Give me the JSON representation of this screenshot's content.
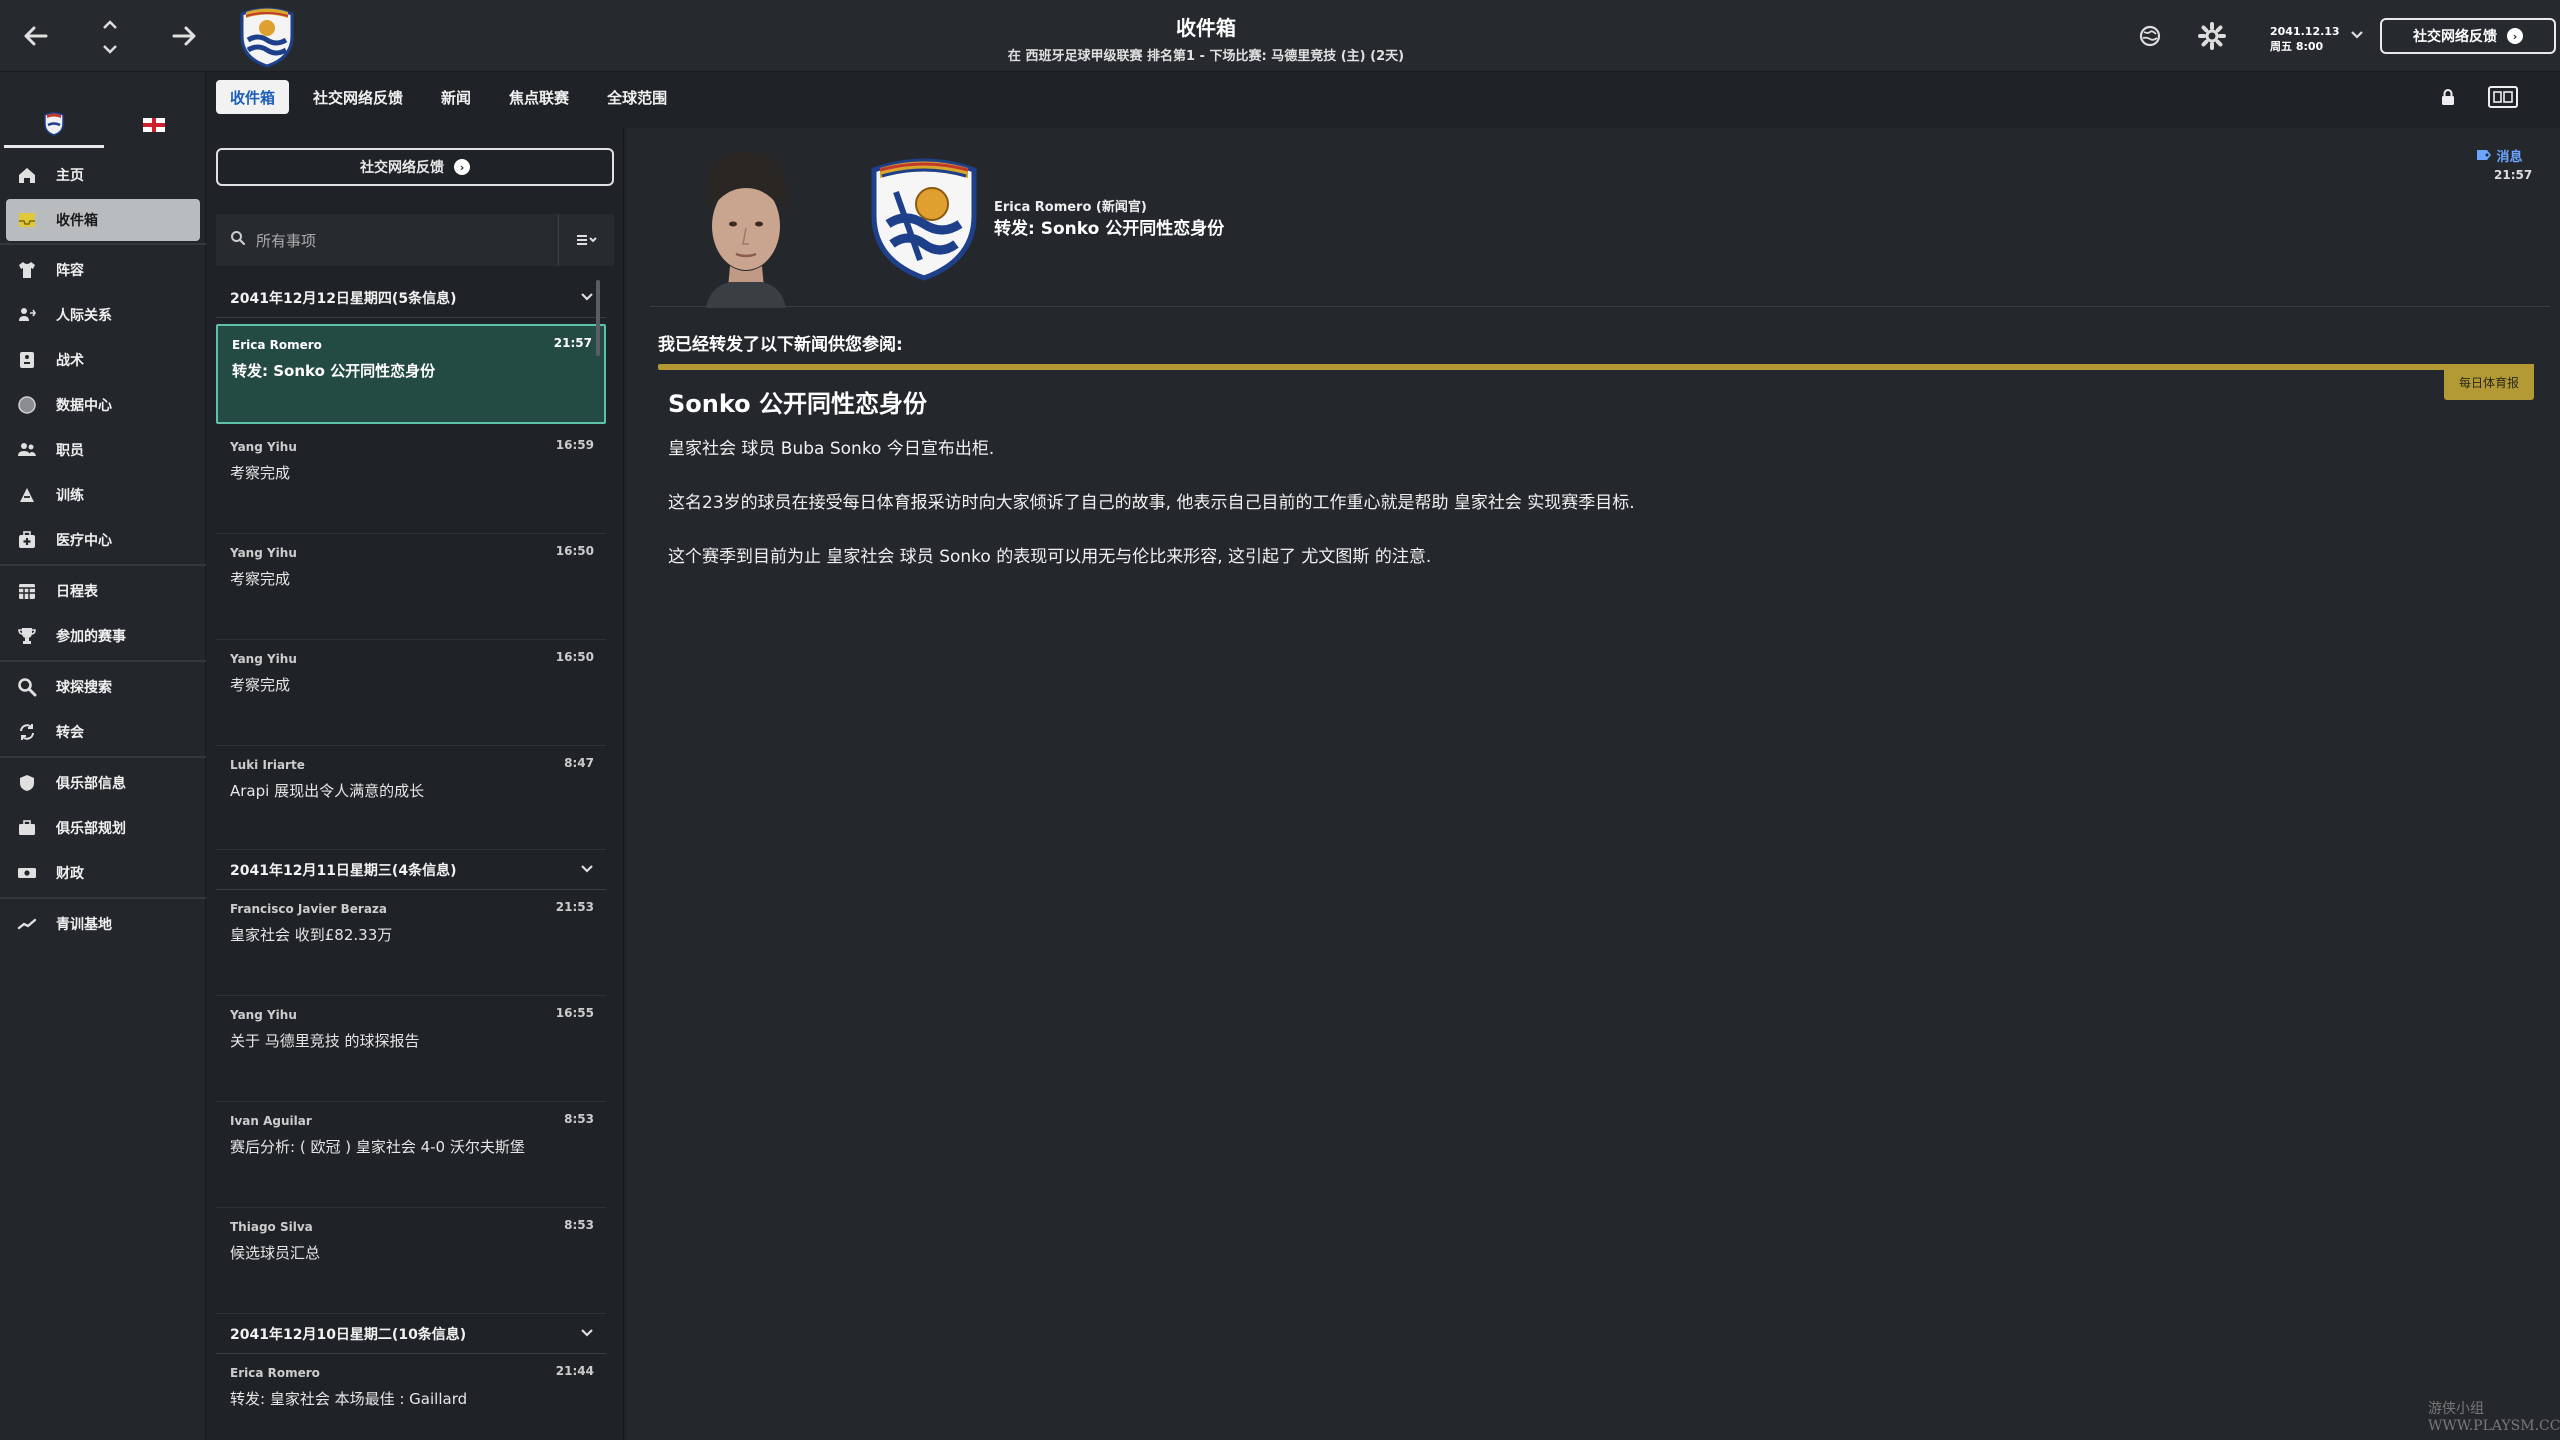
{
  "header": {
    "title": "收件箱",
    "subtitle": "在 西班牙足球甲级联赛 排名第1 - 下场比赛: 马德里竞技 (主) (2天)",
    "date_line1": "2041.12.13",
    "date_line2": "周五 8:00",
    "social_button": "社交网络反馈"
  },
  "icons": {
    "back": "arrow-left-icon",
    "forward": "arrow-right-icon",
    "updown": "chevron-updown-icon",
    "globe": "globe-icon",
    "settings": "gear-icon"
  },
  "sidebar": {
    "items": [
      {
        "label": "主页",
        "icon": "home-icon"
      },
      {
        "label": "收件箱",
        "icon": "inbox-icon"
      },
      {
        "label": "阵容",
        "icon": "shirt-icon"
      },
      {
        "label": "人际关系",
        "icon": "relationships-icon"
      },
      {
        "label": "战术",
        "icon": "tactics-icon"
      },
      {
        "label": "数据中心",
        "icon": "data-icon"
      },
      {
        "label": "职员",
        "icon": "staff-icon"
      },
      {
        "label": "训练",
        "icon": "training-icon"
      },
      {
        "label": "医疗中心",
        "icon": "medical-icon"
      },
      {
        "label": "日程表",
        "icon": "calendar-icon"
      },
      {
        "label": "参加的赛事",
        "icon": "trophy-icon"
      },
      {
        "label": "球探搜索",
        "icon": "search-icon"
      },
      {
        "label": "转会",
        "icon": "transfer-icon"
      },
      {
        "label": "俱乐部信息",
        "icon": "shield-icon"
      },
      {
        "label": "俱乐部规划",
        "icon": "briefcase-icon"
      },
      {
        "label": "财政",
        "icon": "money-icon"
      },
      {
        "label": "青训基地",
        "icon": "youth-icon"
      }
    ]
  },
  "subtabs": [
    "收件箱",
    "社交网络反馈",
    "新闻",
    "焦点联赛",
    "全球范围"
  ],
  "list": {
    "social_button": "社交网络反馈",
    "search_placeholder": "所有事项",
    "groups": [
      {
        "header": "2041年12月12日星期四(5条信息)",
        "messages": [
          {
            "sender": "Erica Romero",
            "time": "21:57",
            "subject": "转发: Sonko 公开同性恋身份"
          },
          {
            "sender": "Yang Yihu",
            "time": "16:59",
            "subject": "考察完成"
          },
          {
            "sender": "Yang Yihu",
            "time": "16:50",
            "subject": "考察完成"
          },
          {
            "sender": "Yang Yihu",
            "time": "16:50",
            "subject": "考察完成"
          },
          {
            "sender": "Luki Iriarte",
            "time": "8:47",
            "subject": "Arapi 展现出令人满意的成长"
          }
        ]
      },
      {
        "header": "2041年12月11日星期三(4条信息)",
        "messages": [
          {
            "sender": "Francisco Javier Beraza",
            "time": "21:53",
            "subject": "皇家社会 收到£82.33万"
          },
          {
            "sender": "Yang Yihu",
            "time": "16:55",
            "subject": "关于 马德里竞技 的球探报告"
          },
          {
            "sender": "Ivan Aguilar",
            "time": "8:53",
            "subject": "赛后分析: ( 欧冠 ) 皇家社会 4-0 沃尔夫斯堡"
          },
          {
            "sender": "Thiago Silva",
            "time": "8:53",
            "subject": "候选球员汇总"
          }
        ]
      },
      {
        "header": "2041年12月10日星期二(10条信息)",
        "messages": [
          {
            "sender": "Erica Romero",
            "time": "21:44",
            "subject": "转发: 皇家社会 本场最佳 : Gaillard"
          }
        ]
      }
    ]
  },
  "reader": {
    "from": "Erica Romero (新闻官)",
    "subject": "转发: Sonko 公开同性恋身份",
    "tag": "消息",
    "time": "21:57",
    "intro": "我已经转发了以下新闻供您参阅:",
    "source": "每日体育报",
    "article_title": "Sonko 公开同性恋身份",
    "paragraphs": [
      "皇家社会 球员 Buba Sonko 今日宣布出柜.",
      "这名23岁的球员在接受每日体育报采访时向大家倾诉了自己的故事, 他表示自己目前的工作重心就是帮助 皇家社会 实现赛季目标.",
      "这个赛季到目前为止 皇家社会 球员 Sonko 的表现可以用无与伦比来形容, 这引起了 尤文图斯 的注意."
    ]
  },
  "watermark": "游侠小组 WWW.PLAYSM.CC",
  "colors": {
    "accent": "#1d5fb8",
    "gold": "#b49a34",
    "selected": "#244a44",
    "selected_border": "#5fc1a8"
  }
}
